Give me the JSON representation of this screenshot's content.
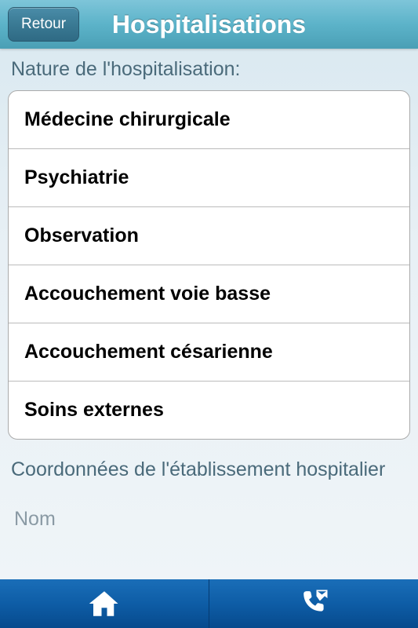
{
  "header": {
    "back_label": "Retour",
    "title": "Hospitalisations"
  },
  "sections": {
    "nature_label": "Nature de l'hospitalisation:",
    "coords_label": "Coordonnées de l'établissement hospitalier"
  },
  "nature_options": [
    "Médecine chirurgicale",
    "Psychiatrie",
    "Observation",
    "Accouchement voie basse",
    "Accouchement césarienne",
    "Soins externes"
  ],
  "input": {
    "name_placeholder": "Nom"
  }
}
